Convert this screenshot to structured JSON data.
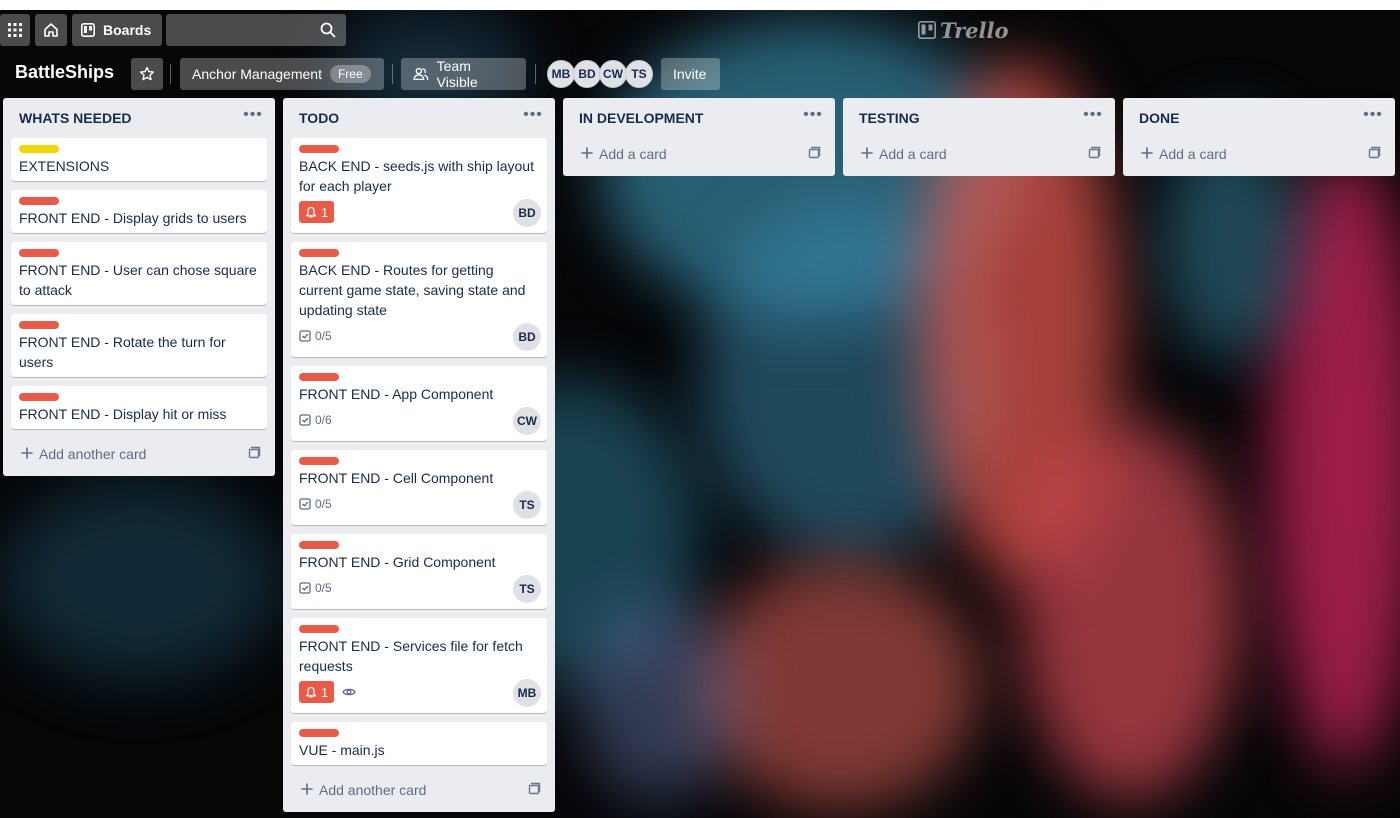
{
  "header": {
    "boards_label": "Boards",
    "search_placeholder": "",
    "logo_text": "Trello"
  },
  "board": {
    "title": "BattleShips",
    "team_name": "Anchor Management",
    "team_plan": "Free",
    "visibility_label": "Team Visible",
    "invite_label": "Invite",
    "members": [
      "MB",
      "BD",
      "CW",
      "TS"
    ]
  },
  "lists": [
    {
      "title": "WHATS NEEDED",
      "add_label": "Add another card",
      "cards": [
        {
          "title": "EXTENSIONS",
          "label_color": "#f2d600"
        },
        {
          "title": "FRONT END - Display grids to users",
          "label_color": "#eb5a46"
        },
        {
          "title": "FRONT END - User can chose square to attack",
          "label_color": "#eb5a46"
        },
        {
          "title": "FRONT END - Rotate the turn for users",
          "label_color": "#eb5a46"
        },
        {
          "title": "FRONT END - Display hit or miss",
          "label_color": "#eb5a46"
        }
      ]
    },
    {
      "title": "TODO",
      "add_label": "Add another card",
      "cards": [
        {
          "title": "BACK END - seeds.js with ship layout for each player",
          "label_color": "#eb5a46",
          "due": "1",
          "member": "BD"
        },
        {
          "title": "BACK END - Routes for getting current game state, saving state and updating state",
          "label_color": "#eb5a46",
          "checklist": "0/5",
          "member": "BD"
        },
        {
          "title": "FRONT END - App Component",
          "label_color": "#eb5a46",
          "checklist": "0/6",
          "member": "CW"
        },
        {
          "title": "FRONT END - Cell Component",
          "label_color": "#eb5a46",
          "checklist": "0/5",
          "member": "TS"
        },
        {
          "title": "FRONT END - Grid Component",
          "label_color": "#eb5a46",
          "checklist": "0/5",
          "member": "TS"
        },
        {
          "title": "FRONT END - Services file for fetch requests",
          "label_color": "#eb5a46",
          "due": "1",
          "member": "MB"
        },
        {
          "title": "VUE - main.js",
          "label_color": "#eb5a46"
        }
      ]
    },
    {
      "title": "IN DEVELOPMENT",
      "add_label": "Add a card",
      "cards": []
    },
    {
      "title": "TESTING",
      "add_label": "Add a card",
      "cards": []
    },
    {
      "title": "DONE",
      "add_label": "Add a card",
      "cards": []
    }
  ]
}
